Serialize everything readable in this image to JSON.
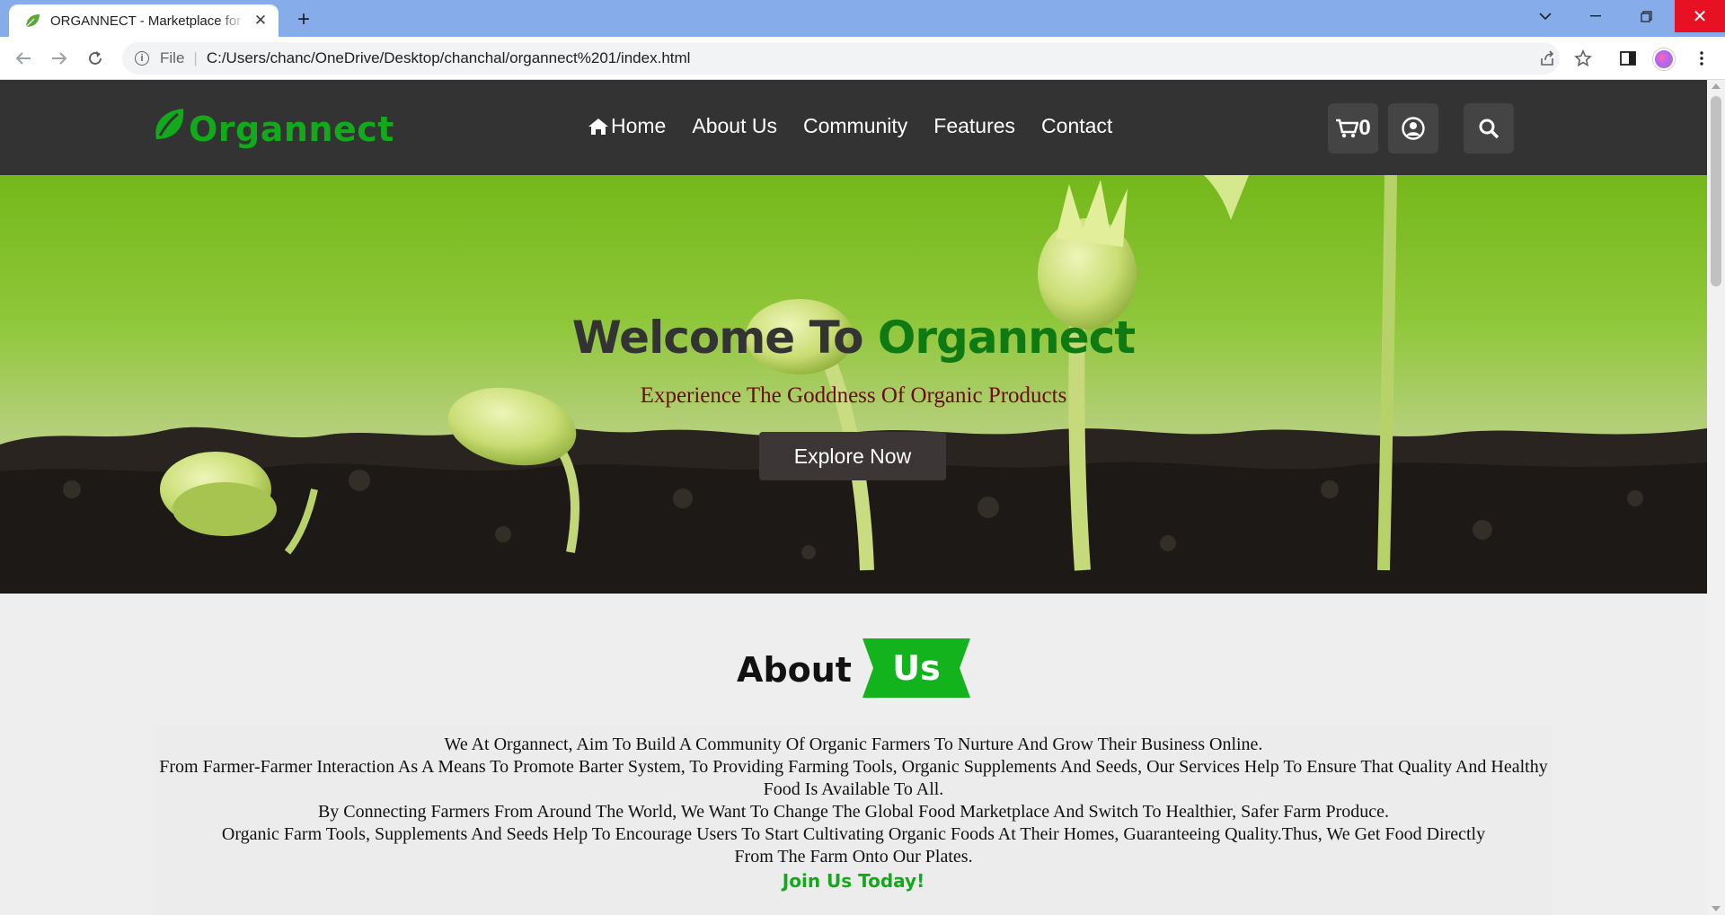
{
  "browser": {
    "tab_title": "ORGANNECT - Marketplace for Organic Products",
    "url_scheme": "File",
    "url": "C:/Users/chanc/OneDrive/Desktop/chanchal/organnect%201/index.html"
  },
  "site": {
    "logo_text": "Organnect",
    "nav": [
      "Home",
      "About Us",
      "Community",
      "Features",
      "Contact"
    ],
    "cart_count": "0",
    "brand_color": "#12a91b",
    "header_bg": "#333333"
  },
  "hero": {
    "title_prefix": "Welcome To ",
    "title_accent": "Organnect",
    "subtitle": "Experience The Goddness Of Organic Products",
    "cta": "Explore Now"
  },
  "about": {
    "heading_word": "About",
    "heading_highlight": "Us",
    "lines": [
      "We At Organnect, Aim To Build A Community Of Organic Farmers To Nurture And Grow Their Business Online.",
      "From Farmer-Farmer Interaction As A Means To Promote Barter System, To Providing Farming Tools, Organic Supplements And Seeds, Our Services Help To Ensure That Quality And Healthy Food Is Available To All.",
      "By Connecting Farmers From Around The World, We Want To Change The Global Food Marketplace And Switch To Healthier, Safer Farm Produce.",
      "Organic Farm Tools, Supplements And Seeds Help To Encourage Users To Start Cultivating Organic Foods At Their Homes, Guaranteeing Quality.Thus, We Get Food Directly From The Farm Onto Our Plates."
    ],
    "join_text": "Join Us Today!"
  }
}
